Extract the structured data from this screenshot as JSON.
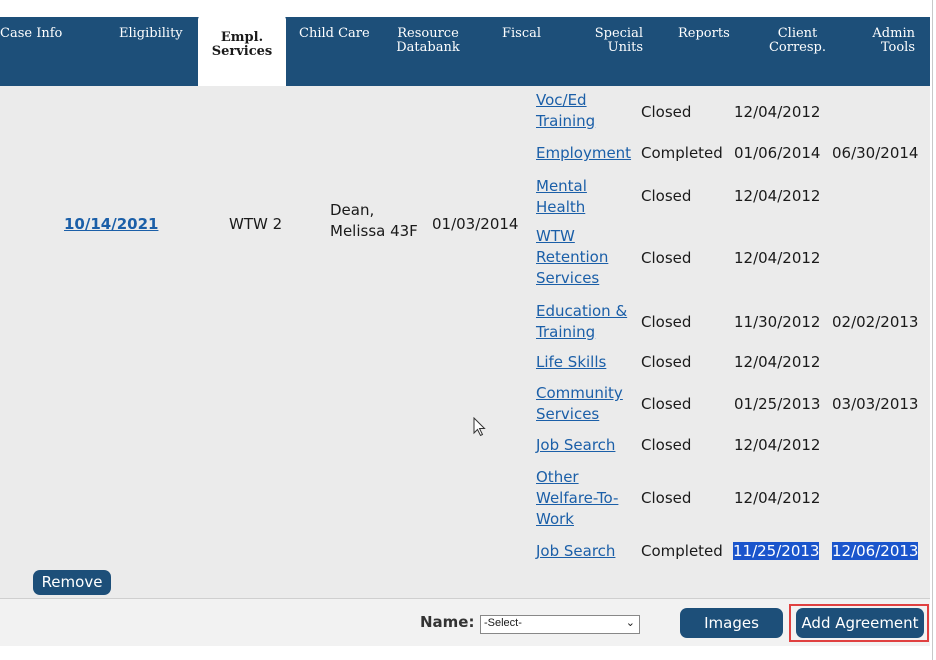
{
  "nav": {
    "tabs": [
      {
        "line1": "Case Info",
        "line2": ""
      },
      {
        "line1": "Eligibility",
        "line2": ""
      },
      {
        "line1": "Empl.",
        "line2": "Services"
      },
      {
        "line1": "Child Care",
        "line2": ""
      },
      {
        "line1": "Resource",
        "line2": "Databank"
      },
      {
        "line1": "Fiscal",
        "line2": ""
      },
      {
        "line1": "Special",
        "line2": "Units"
      },
      {
        "line1": "Reports",
        "line2": ""
      },
      {
        "line1": "Client",
        "line2": "Corresp."
      },
      {
        "line1": "Admin",
        "line2": "Tools"
      }
    ],
    "active_tab": "Empl. Services"
  },
  "record": {
    "date": "10/14/2021",
    "program": "WTW 2",
    "name_line1": "Dean,",
    "name_line2": "Melissa 43F",
    "start_date": "01/03/2014"
  },
  "services": [
    {
      "lines": [
        "Voc/Ed",
        "Training"
      ],
      "status": "Closed",
      "start": "12/04/2012",
      "end": ""
    },
    {
      "lines": [
        "Employment"
      ],
      "status": "Completed",
      "start": "01/06/2014",
      "end": "06/30/2014"
    },
    {
      "lines": [
        "Mental",
        "Health"
      ],
      "status": "Closed",
      "start": "12/04/2012",
      "end": ""
    },
    {
      "lines": [
        "WTW",
        "Retention",
        "Services"
      ],
      "status": "Closed",
      "start": "12/04/2012",
      "end": ""
    },
    {
      "lines": [
        "Education &",
        "Training"
      ],
      "status": "Closed",
      "start": "11/30/2012",
      "end": "02/02/2013"
    },
    {
      "lines": [
        "Life Skills"
      ],
      "status": "Closed",
      "start": "12/04/2012",
      "end": ""
    },
    {
      "lines": [
        "Community",
        "Services"
      ],
      "status": "Closed",
      "start": "01/25/2013",
      "end": "03/03/2013"
    },
    {
      "lines": [
        "Job Search"
      ],
      "status": "Closed",
      "start": "12/04/2012",
      "end": ""
    },
    {
      "lines": [
        "Other",
        "Welfare-To-",
        "Work"
      ],
      "status": "Closed",
      "start": "12/04/2012",
      "end": ""
    },
    {
      "lines": [
        "Job Search"
      ],
      "status": "Completed",
      "start": "11/25/2013",
      "end": "12/06/2013",
      "selected": true
    }
  ],
  "buttons": {
    "remove": "Remove",
    "images": "Images",
    "add_agreement": "Add Agreement"
  },
  "footer": {
    "name_label": "Name:",
    "name_select_value": "-Select-"
  },
  "colors": {
    "nav_bg": "#1d4f79",
    "link": "#1b5fa8",
    "selection": "#1a55cc",
    "highlight_box": "#e04040"
  }
}
